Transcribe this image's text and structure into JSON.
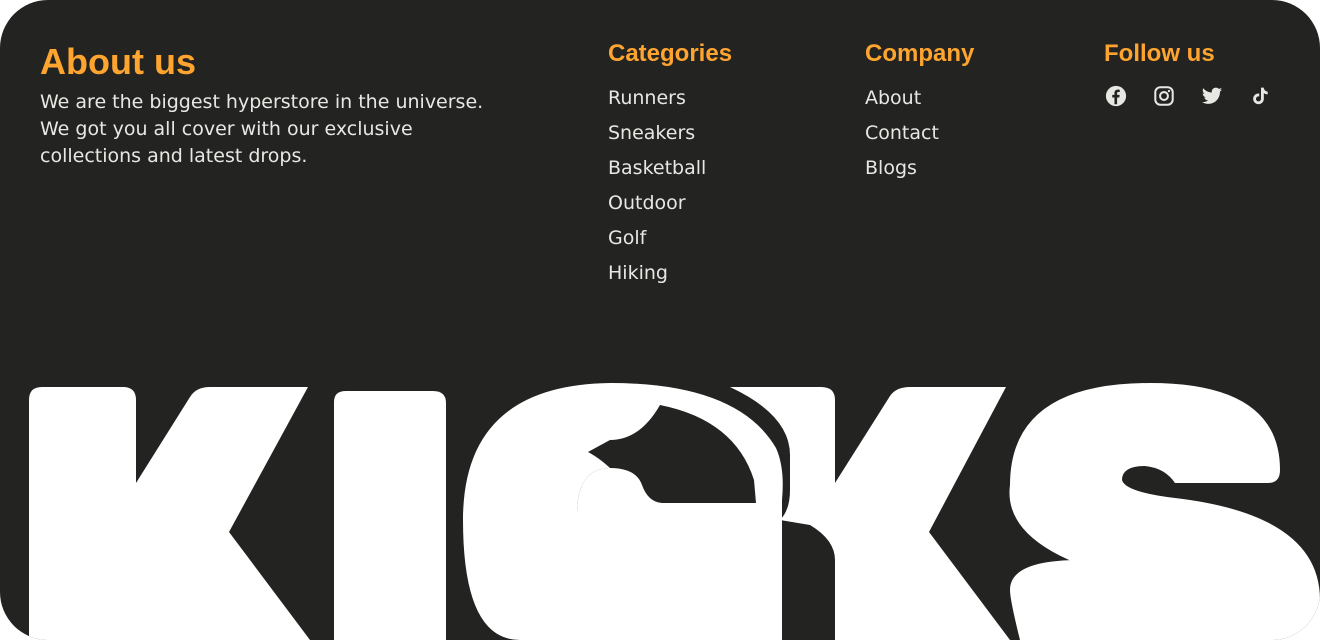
{
  "about": {
    "title": "About us",
    "description": "We are the biggest hyperstore in the universe. We got you all cover with our exclusive collections and latest drops."
  },
  "categories": {
    "title": "Categories",
    "items": [
      "Runners",
      "Sneakers",
      "Basketball",
      "Outdoor",
      "Golf",
      "Hiking"
    ]
  },
  "company": {
    "title": "Company",
    "items": [
      "About",
      "Contact",
      "Blogs"
    ]
  },
  "follow": {
    "title": "Follow us",
    "icons": [
      "facebook-icon",
      "instagram-icon",
      "twitter-icon",
      "tiktok-icon"
    ]
  },
  "brand": {
    "logo_text": "KICKS"
  },
  "colors": {
    "background": "#232321",
    "accent": "#FFA52F",
    "text": "#E7E7E3",
    "logo": "#FFFFFF"
  }
}
